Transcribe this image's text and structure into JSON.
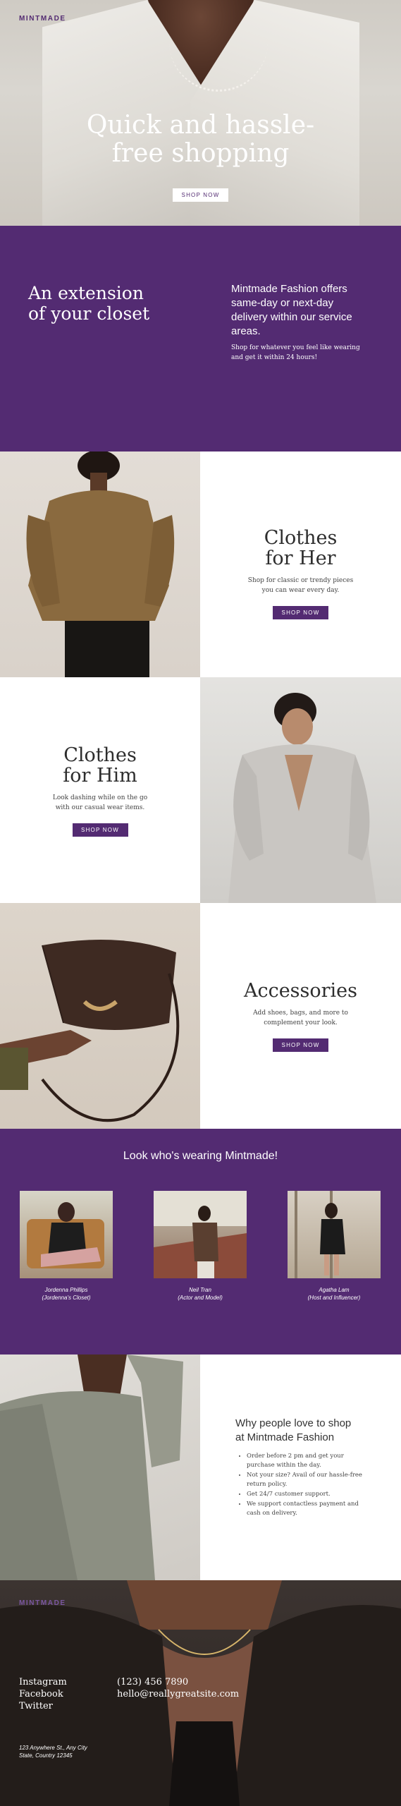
{
  "brand": "MINTMADE",
  "hero": {
    "title_line1": "Quick and hassle-",
    "title_line2": "free shopping",
    "cta": "SHOP NOW"
  },
  "extension": {
    "heading_line1": "An extension",
    "heading_line2": "of your closet",
    "lead": "Mintmade Fashion offers same-day or next-day delivery within our service areas.",
    "detail": "Shop for whatever you feel like wearing and get it within 24 hours!"
  },
  "her": {
    "title_line1": "Clothes",
    "title_line2": "for Her",
    "text_line1": "Shop for classic or trendy pieces",
    "text_line2": "you can wear every day.",
    "cta": "SHOP NOW"
  },
  "him": {
    "title_line1": "Clothes",
    "title_line2": "for Him",
    "text_line1": "Look dashing while on the go",
    "text_line2": "with our casual wear items.",
    "cta": "SHOP NOW"
  },
  "accessories": {
    "title": "Accessories",
    "text_line1": "Add shoes, bags, and more to",
    "text_line2": "complement your look.",
    "cta": "SHOP NOW"
  },
  "wearing": {
    "heading": "Look who's wearing Mintmade!",
    "people": [
      {
        "name": "Jordenna Phillips",
        "role": "(Jordenna's Closet)"
      },
      {
        "name": "Neil Tran",
        "role": "(Actor and Model)"
      },
      {
        "name": "Agatha Lam",
        "role": "(Host and Influencer)"
      }
    ]
  },
  "why": {
    "heading_line1": "Why people love to shop",
    "heading_line2": "at Mintmade Fashion",
    "reasons": [
      "Order before 2 pm and get your purchase within the day.",
      "Not your size? Avail of our hassle-free return policy.",
      "Get 24/7 customer support.",
      "We support contactless payment and cash on delivery."
    ]
  },
  "footer": {
    "logo": "MINTMADE",
    "social": [
      "Instagram",
      "Facebook",
      "Twitter"
    ],
    "phone": "(123) 456 7890",
    "email": "hello@reallygreatsite.com",
    "address_line1": "123 Anywhere St., Any City",
    "address_line2": "State, Country 12345"
  },
  "colors": {
    "accent": "#532b72",
    "white": "#ffffff"
  }
}
